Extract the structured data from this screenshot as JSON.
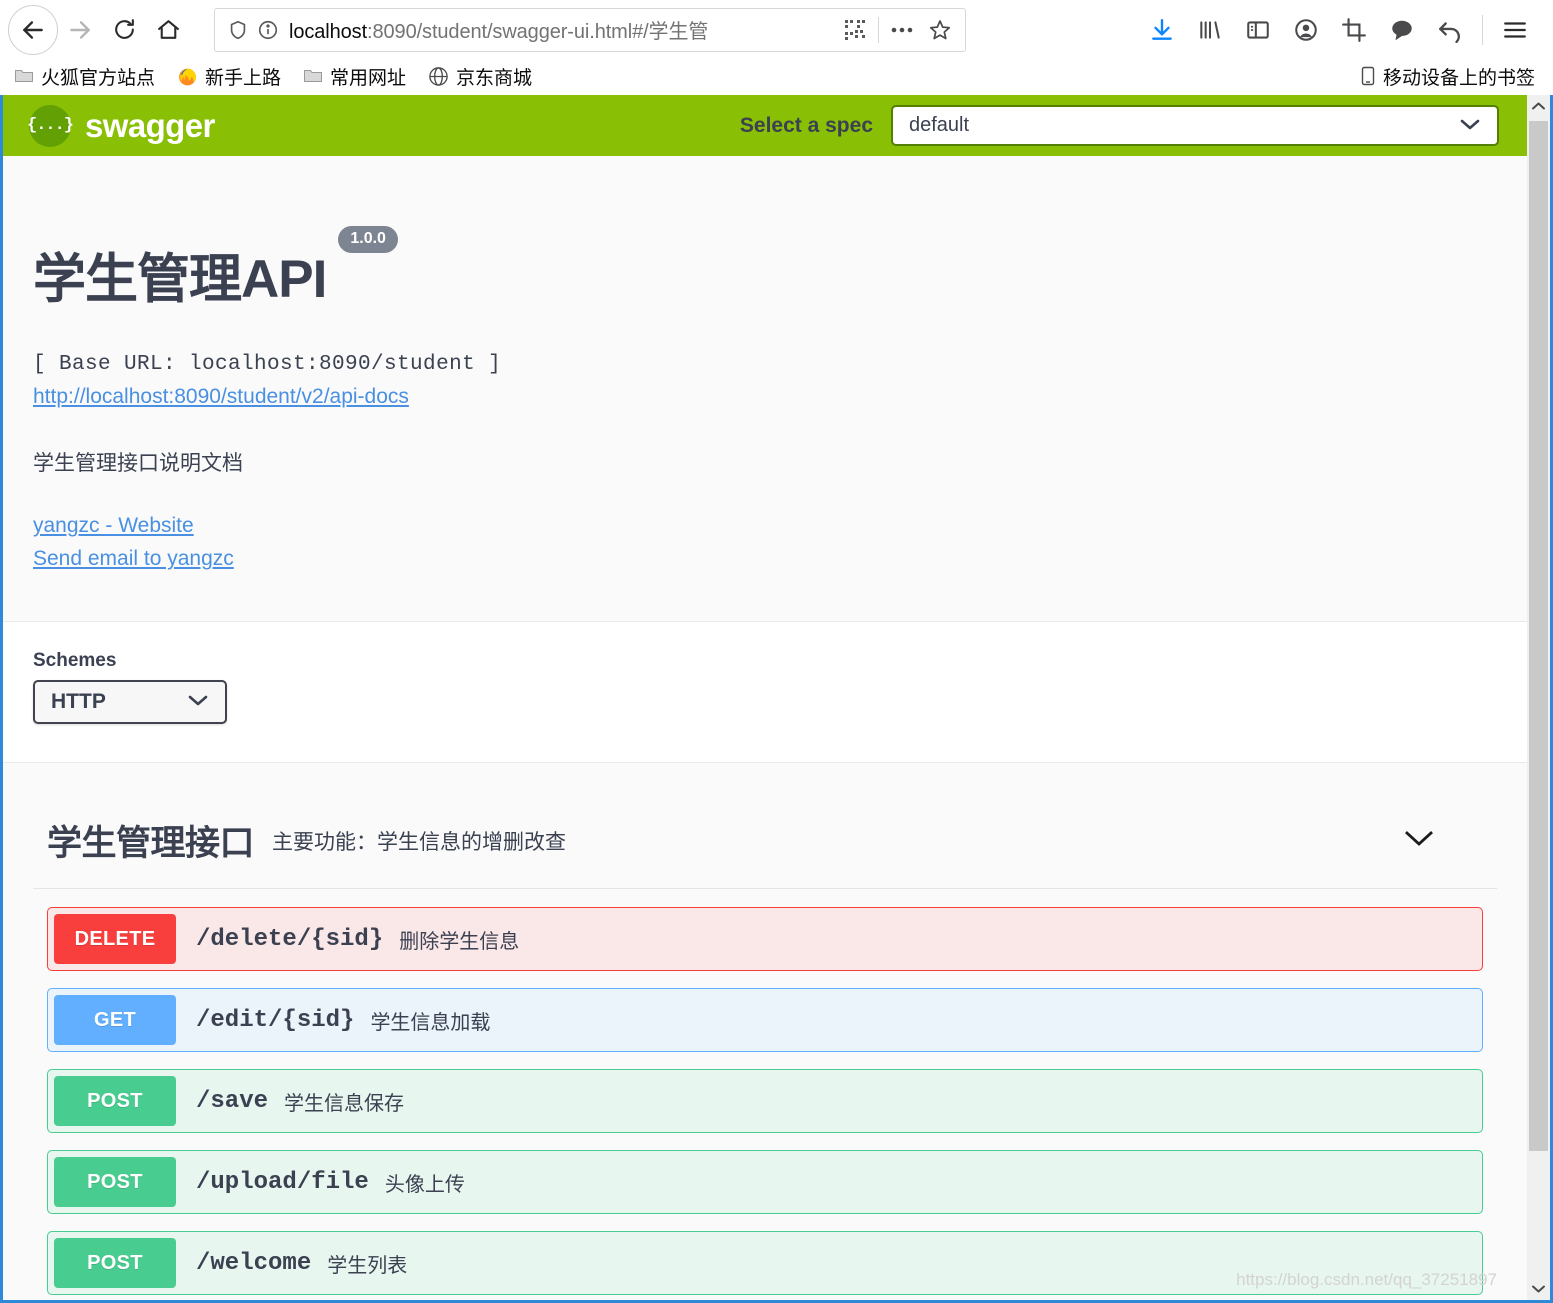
{
  "browser": {
    "url_prefix": "localhost",
    "url_rest": ":8090/student/swagger-ui.html#/学生管",
    "nav": {
      "back": "back-button",
      "forward": "forward-button",
      "reload": "reload-button",
      "home": "home-button"
    },
    "toolbar_icons": [
      "download-icon",
      "library-icon",
      "sidebar-icon",
      "account-icon",
      "screenshot-icon",
      "pocket-icon",
      "undo-icon",
      "menu-icon"
    ],
    "url_icons": [
      "shield-icon",
      "info-icon",
      "qrcode-icon",
      "ellipsis-icon",
      "star-icon"
    ],
    "bookmarks": [
      {
        "label": "火狐官方站点",
        "icon": "folder-icon"
      },
      {
        "label": "新手上路",
        "icon": "firefox-icon"
      },
      {
        "label": "常用网址",
        "icon": "folder-icon"
      },
      {
        "label": "京东商城",
        "icon": "globe-icon"
      }
    ],
    "bookmarks_right": {
      "label": "移动设备上的书签",
      "icon": "mobile-icon"
    }
  },
  "topbar": {
    "logo_text": "swagger",
    "logo_mark": "{...}",
    "select_spec_label": "Select a spec",
    "spec_value": "default",
    "bg_color": "#89bf04"
  },
  "info": {
    "title": "学生管理API",
    "version": "1.0.0",
    "base_url": "[ Base URL: localhost:8090/student ]",
    "api_docs_url": "http://localhost:8090/student/v2/api-docs",
    "description": "学生管理接口说明文档",
    "contact_website": "yangzc - Website",
    "contact_email": "Send email to yangzc"
  },
  "schemes": {
    "label": "Schemes",
    "value": "HTTP"
  },
  "tag": {
    "name": "学生管理接口",
    "description": "主要功能：学生信息的增删改查",
    "toggle_icon": "chevron-down-icon"
  },
  "operations": [
    {
      "method": "DELETE",
      "path": "/delete/{sid}",
      "summary": "删除学生信息",
      "style": "op-delete",
      "color": "#f93e3e"
    },
    {
      "method": "GET",
      "path": "/edit/{sid}",
      "summary": "学生信息加载",
      "style": "op-get",
      "color": "#61affe"
    },
    {
      "method": "POST",
      "path": "/save",
      "summary": "学生信息保存",
      "style": "op-post",
      "color": "#49cc90"
    },
    {
      "method": "POST",
      "path": "/upload/file",
      "summary": "头像上传",
      "style": "op-post",
      "color": "#49cc90"
    },
    {
      "method": "POST",
      "path": "/welcome",
      "summary": "学生列表",
      "style": "op-post",
      "color": "#49cc90"
    }
  ],
  "watermark": "https://blog.csdn.net/qq_37251897"
}
